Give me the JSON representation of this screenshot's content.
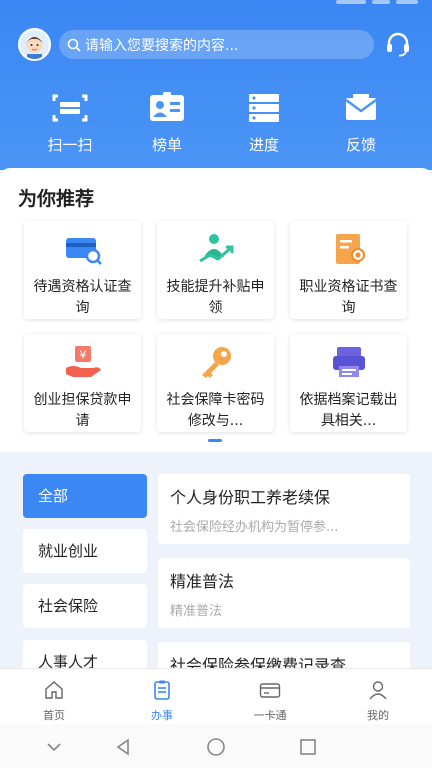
{
  "header": {
    "search_placeholder": "请输入您要搜索的内容...",
    "quick_actions": [
      {
        "label": "扫一扫",
        "icon": "scan-icon"
      },
      {
        "label": "榜单",
        "icon": "ranking-icon"
      },
      {
        "label": "进度",
        "icon": "progress-icon"
      },
      {
        "label": "反馈",
        "icon": "feedback-icon"
      }
    ]
  },
  "recommend": {
    "title": "为你推荐",
    "tiles": [
      {
        "label": "待遇资格认证查询",
        "icon": "card-search-icon"
      },
      {
        "label": "技能提升补贴申领",
        "icon": "skill-growth-icon"
      },
      {
        "label": "职业资格证书查询",
        "icon": "certificate-icon"
      },
      {
        "label": "创业担保贷款申请",
        "icon": "loan-hand-icon"
      },
      {
        "label": "社会保障卡密码修改与...",
        "icon": "key-icon"
      },
      {
        "label": "依据档案记载出具相关...",
        "icon": "printer-icon"
      }
    ]
  },
  "categories": [
    {
      "label": "全部",
      "active": true
    },
    {
      "label": "就业创业",
      "active": false
    },
    {
      "label": "社会保险",
      "active": false
    },
    {
      "label": "人事人才",
      "active": false
    }
  ],
  "services": [
    {
      "title": "个人身份职工养老续保",
      "subtitle": "社会保险经办机构为暂停参..."
    },
    {
      "title": "精准普法",
      "subtitle": "精准普法"
    },
    {
      "title": "社会保险参保缴费记录查",
      "subtitle": ""
    }
  ],
  "bottom_nav": [
    {
      "label": "首页",
      "icon": "home-icon",
      "active": false
    },
    {
      "label": "办事",
      "icon": "service-icon",
      "active": true
    },
    {
      "label": "一卡通",
      "icon": "card-icon",
      "active": false
    },
    {
      "label": "我的",
      "icon": "user-icon",
      "active": false
    }
  ],
  "colors": {
    "accent": "#3b87f3",
    "header_top": "#3b87f3",
    "page_bg": "#eef3fb"
  }
}
